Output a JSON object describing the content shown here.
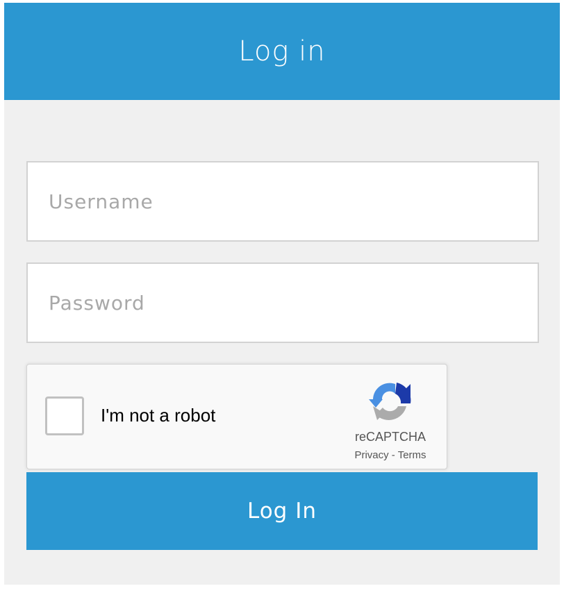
{
  "header": {
    "title": "Log in"
  },
  "form": {
    "username": {
      "placeholder": "Username",
      "value": ""
    },
    "password": {
      "placeholder": "Password",
      "value": ""
    },
    "submit_label": "Log In"
  },
  "captcha": {
    "label": "I'm not a robot",
    "brand": "reCAPTCHA",
    "privacy_label": "Privacy",
    "separator": "-",
    "terms_label": "Terms",
    "logo_icon": "recaptcha-logo-icon",
    "checked": false
  },
  "colors": {
    "accent": "#2b97d1",
    "background": "#f0f0f0",
    "field_border": "#d2d2d2",
    "placeholder": "#a8a8a8"
  }
}
